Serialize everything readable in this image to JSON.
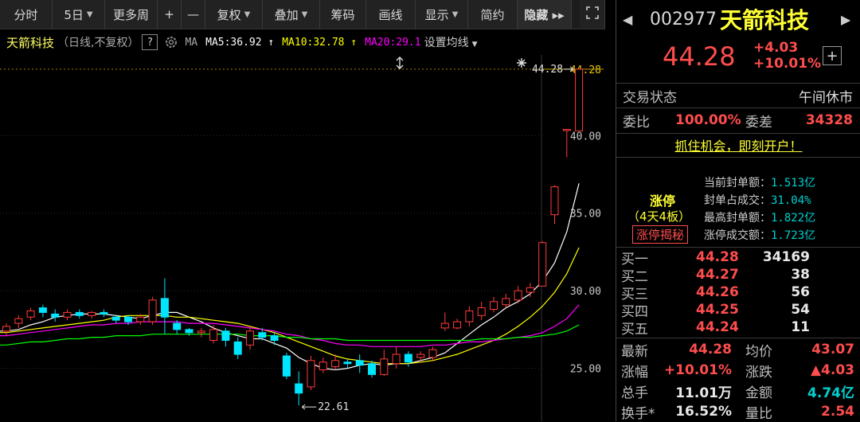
{
  "toolbar": {
    "items": [
      {
        "label": "分时",
        "caret": false
      },
      {
        "label": "5日",
        "caret": true
      },
      {
        "label": "更多周",
        "caret": false
      },
      {
        "label": "+",
        "caret": false
      },
      {
        "label": "—",
        "caret": false
      },
      {
        "label": "复权",
        "caret": true
      },
      {
        "label": "叠加",
        "caret": true
      },
      {
        "label": "筹码",
        "caret": false
      },
      {
        "label": "画线",
        "caret": false
      },
      {
        "label": "显示",
        "caret": true
      },
      {
        "label": "简约",
        "caret": false
      },
      {
        "label": "隐藏 ▸▸",
        "caret": false
      }
    ]
  },
  "info": {
    "name": "天箭科技",
    "mode": "（日线,不复权）",
    "help": "?",
    "ma_label": "MA",
    "ma5": "MA5:36.92 ↑",
    "ma10": "MA10:32.78 ↑",
    "ma20": "MA20:29.1",
    "settings": "设置均线",
    "colors": {
      "ma5": "#ffffff",
      "ma10": "#ffff00",
      "ma20": "#ff00ff",
      "ma60": "#00ff00"
    }
  },
  "chart_data": {
    "type": "candlestick",
    "title": "天箭科技",
    "ylim": [
      22.0,
      45.2
    ],
    "y_ticks": [
      "44.28",
      "40.00",
      "35.00",
      "30.00",
      "25.00"
    ],
    "y_tick_values": [
      44.28,
      40.0,
      35.0,
      30.0,
      25.0
    ],
    "last_price_label": "44.28",
    "low_label": "22.61",
    "candles": [
      {
        "o": 27.4,
        "c": 27.7,
        "h": 27.9,
        "l": 27.1
      },
      {
        "o": 27.9,
        "c": 28.2,
        "h": 28.4,
        "l": 27.6
      },
      {
        "o": 28.3,
        "c": 28.7,
        "h": 28.9,
        "l": 28.1
      },
      {
        "o": 28.9,
        "c": 28.6,
        "h": 29.1,
        "l": 28.3
      },
      {
        "o": 28.5,
        "c": 28.3,
        "h": 28.8,
        "l": 28.0
      },
      {
        "o": 28.3,
        "c": 28.6,
        "h": 28.8,
        "l": 28.1
      },
      {
        "o": 28.6,
        "c": 28.4,
        "h": 28.8,
        "l": 28.2
      },
      {
        "o": 28.4,
        "c": 28.6,
        "h": 28.7,
        "l": 28.2
      },
      {
        "o": 28.6,
        "c": 28.5,
        "h": 28.8,
        "l": 28.3
      },
      {
        "o": 28.3,
        "c": 28.1,
        "h": 28.4,
        "l": 27.9
      },
      {
        "o": 28.3,
        "c": 28.0,
        "h": 28.4,
        "l": 27.8
      },
      {
        "o": 28.0,
        "c": 28.3,
        "h": 28.5,
        "l": 27.8
      },
      {
        "o": 28.0,
        "c": 29.4,
        "h": 29.6,
        "l": 27.8
      },
      {
        "o": 29.5,
        "c": 28.3,
        "h": 30.8,
        "l": 27.2
      },
      {
        "o": 27.9,
        "c": 27.5,
        "h": 28.1,
        "l": 27.2
      },
      {
        "o": 27.5,
        "c": 27.3,
        "h": 27.6,
        "l": 27.1
      },
      {
        "o": 27.3,
        "c": 27.4,
        "h": 27.6,
        "l": 27.0
      },
      {
        "o": 26.8,
        "c": 27.5,
        "h": 27.8,
        "l": 26.6
      },
      {
        "o": 27.4,
        "c": 26.8,
        "h": 27.6,
        "l": 26.4
      },
      {
        "o": 26.7,
        "c": 25.9,
        "h": 27.0,
        "l": 25.6
      },
      {
        "o": 26.5,
        "c": 27.4,
        "h": 27.7,
        "l": 26.2
      },
      {
        "o": 27.3,
        "c": 27.0,
        "h": 27.6,
        "l": 26.8
      },
      {
        "o": 27.1,
        "c": 26.8,
        "h": 27.3,
        "l": 26.5
      },
      {
        "o": 25.8,
        "c": 24.5,
        "h": 26.0,
        "l": 24.3
      },
      {
        "o": 24.0,
        "c": 23.4,
        "h": 24.8,
        "l": 22.61
      },
      {
        "o": 23.8,
        "c": 25.5,
        "h": 25.8,
        "l": 23.6
      },
      {
        "o": 24.9,
        "c": 25.4,
        "h": 25.7,
        "l": 24.7
      },
      {
        "o": 25.1,
        "c": 25.5,
        "h": 25.9,
        "l": 24.9
      },
      {
        "o": 25.4,
        "c": 25.3,
        "h": 25.6,
        "l": 25.0
      },
      {
        "o": 25.5,
        "c": 25.2,
        "h": 25.9,
        "l": 24.7
      },
      {
        "o": 25.3,
        "c": 24.6,
        "h": 25.5,
        "l": 24.4
      },
      {
        "o": 24.6,
        "c": 25.6,
        "h": 26.2,
        "l": 24.5
      },
      {
        "o": 25.3,
        "c": 25.9,
        "h": 26.4,
        "l": 25.0
      },
      {
        "o": 25.9,
        "c": 25.4,
        "h": 26.1,
        "l": 25.1
      },
      {
        "o": 25.7,
        "c": 25.9,
        "h": 26.1,
        "l": 25.4
      },
      {
        "o": 25.7,
        "c": 26.2,
        "h": 26.4,
        "l": 25.5
      },
      {
        "o": 27.6,
        "c": 27.9,
        "h": 28.6,
        "l": 27.4
      },
      {
        "o": 27.6,
        "c": 28.0,
        "h": 28.2,
        "l": 27.5
      },
      {
        "o": 28.0,
        "c": 28.7,
        "h": 29.0,
        "l": 27.7
      },
      {
        "o": 28.4,
        "c": 28.9,
        "h": 29.3,
        "l": 28.1
      },
      {
        "o": 28.8,
        "c": 29.3,
        "h": 29.6,
        "l": 28.6
      },
      {
        "o": 29.1,
        "c": 29.5,
        "h": 29.8,
        "l": 28.9
      },
      {
        "o": 29.4,
        "c": 30.0,
        "h": 30.3,
        "l": 29.2
      },
      {
        "o": 29.9,
        "c": 30.2,
        "h": 30.5,
        "l": 29.6
      },
      {
        "o": 30.3,
        "c": 33.1,
        "h": 33.2,
        "l": 30.3
      },
      {
        "o": 34.9,
        "c": 36.7,
        "h": 36.8,
        "l": 34.3
      },
      {
        "o": 40.35,
        "c": 40.4,
        "h": 40.4,
        "l": 38.6
      },
      {
        "o": 40.3,
        "c": 44.28,
        "h": 44.28,
        "l": 40.3
      }
    ],
    "series": [
      {
        "name": "MA5",
        "values": [
          27.4,
          27.5,
          27.8,
          28.0,
          28.3,
          28.4,
          28.5,
          28.5,
          28.5,
          28.4,
          28.3,
          28.2,
          28.4,
          28.6,
          28.6,
          28.3,
          28.0,
          27.6,
          27.3,
          27.1,
          26.9,
          26.9,
          26.6,
          26.3,
          25.7,
          25.3,
          25.0,
          24.9,
          25.0,
          25.2,
          25.3,
          25.2,
          25.3,
          25.3,
          25.5,
          25.7,
          26.0,
          26.6,
          27.2,
          27.8,
          28.3,
          28.9,
          29.3,
          29.8,
          30.6,
          31.8,
          33.8,
          36.92
        ]
      },
      {
        "name": "MA10",
        "values": [
          27.3,
          27.4,
          27.5,
          27.6,
          27.7,
          27.8,
          27.9,
          28.0,
          28.1,
          28.3,
          28.4,
          28.4,
          28.4,
          28.4,
          28.3,
          28.3,
          28.2,
          28.1,
          28.0,
          27.9,
          27.7,
          27.5,
          27.3,
          27.0,
          26.7,
          26.4,
          26.1,
          25.8,
          25.6,
          25.5,
          25.4,
          25.3,
          25.3,
          25.3,
          25.4,
          25.5,
          25.7,
          25.9,
          26.2,
          26.5,
          26.8,
          27.2,
          27.7,
          28.3,
          29.0,
          29.9,
          31.1,
          32.78
        ]
      },
      {
        "name": "MA20",
        "values": [
          27.1,
          27.2,
          27.3,
          27.4,
          27.5,
          27.6,
          27.7,
          27.8,
          27.8,
          27.9,
          27.9,
          28.0,
          28.0,
          28.0,
          28.0,
          27.9,
          27.9,
          27.9,
          27.8,
          27.7,
          27.6,
          27.5,
          27.4,
          27.2,
          27.1,
          26.9,
          26.8,
          26.6,
          26.5,
          26.5,
          26.4,
          26.4,
          26.4,
          26.4,
          26.4,
          26.5,
          26.5,
          26.6,
          26.7,
          26.7,
          26.8,
          26.9,
          27.0,
          27.1,
          27.3,
          27.7,
          28.2,
          29.1
        ]
      },
      {
        "name": "MA60",
        "values": [
          26.5,
          26.6,
          26.7,
          26.7,
          26.8,
          26.9,
          26.9,
          27.0,
          27.0,
          27.1,
          27.1,
          27.1,
          27.2,
          27.2,
          27.2,
          27.2,
          27.2,
          27.2,
          27.2,
          27.2,
          27.1,
          27.1,
          27.1,
          27.0,
          27.0,
          26.9,
          26.9,
          26.9,
          26.8,
          26.8,
          26.8,
          26.8,
          26.8,
          26.8,
          26.8,
          26.8,
          26.8,
          26.8,
          26.8,
          26.9,
          26.9,
          26.9,
          27.0,
          27.0,
          27.1,
          27.2,
          27.4,
          27.8
        ]
      }
    ]
  },
  "quote": {
    "code": "002977",
    "name": "天箭科技",
    "price": "44.28",
    "change": "+4.03",
    "pct": "+10.01%",
    "plus_button": "+"
  },
  "status": {
    "label": "交易状态",
    "value": "午间休市"
  },
  "ratio": {
    "label1": "委比",
    "value1": "100.00%",
    "label2": "委差",
    "value2": "34328"
  },
  "promo": "抓住机会，即刻开户！",
  "limit_up": {
    "title": "涨停",
    "days": "（4天4板）",
    "secret_button": "涨停揭秘",
    "lines": [
      {
        "label": "当前封单额：",
        "value": "1.513亿"
      },
      {
        "label": "封单占成交：",
        "value": "31.04%"
      },
      {
        "label": "最高封单额：",
        "value": "1.822亿"
      },
      {
        "label": "涨停成交额：",
        "value": "1.723亿"
      }
    ]
  },
  "bids": [
    {
      "label": "买一",
      "price": "44.28",
      "vol": "34169"
    },
    {
      "label": "买二",
      "price": "44.27",
      "vol": "38"
    },
    {
      "label": "买三",
      "price": "44.26",
      "vol": "56"
    },
    {
      "label": "买四",
      "price": "44.25",
      "vol": "54"
    },
    {
      "label": "买五",
      "price": "44.24",
      "vol": "11"
    }
  ],
  "stats": [
    {
      "l1": "最新",
      "v1": "44.28",
      "c1": "#ff4d4d",
      "l2": "均价",
      "v2": "43.07",
      "c2": "#ff4d4d"
    },
    {
      "l1": "涨幅",
      "v1": "+10.01%",
      "c1": "#ff4d4d",
      "l2": "涨跌",
      "v2": "▲4.03",
      "c2": "#ff4d4d"
    },
    {
      "l1": "总手",
      "v1": "11.01万",
      "c1": "#e8e8e8",
      "l2": "金额",
      "v2": "4.74亿",
      "c2": "#00d0d0"
    },
    {
      "l1": "换手*",
      "v1": "16.52%",
      "c1": "#e8e8e8",
      "l2": "量比",
      "v2": "2.54",
      "c2": "#ff4d4d"
    }
  ]
}
